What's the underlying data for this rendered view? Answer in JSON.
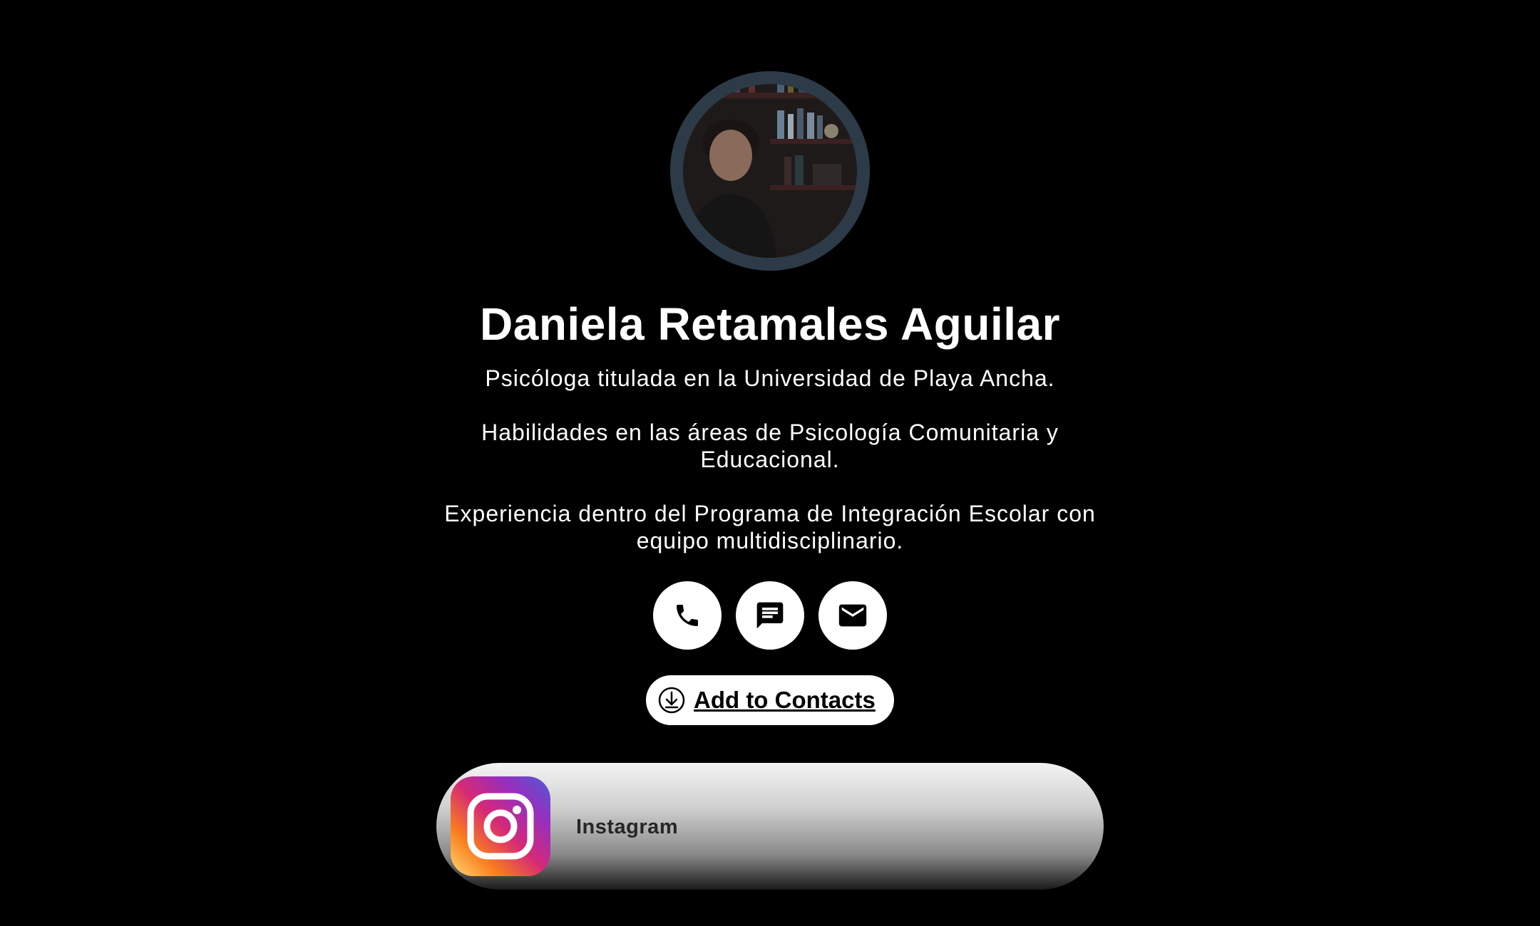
{
  "profile": {
    "name": "Daniela Retamales Aguilar",
    "avatar_icon": "profile-photo",
    "bio": [
      "Psicóloga titulada en la Universidad de Playa Ancha.",
      "Habilidades en las áreas de Psicología Comunitaria y Educacional.",
      "Experiencia dentro del Programa de Integración Escolar con equipo multidisciplinario."
    ]
  },
  "actions": {
    "buttons": [
      {
        "icon": "phone-icon"
      },
      {
        "icon": "message-icon"
      },
      {
        "icon": "email-icon"
      }
    ],
    "add_contacts_label": "Add to Contacts",
    "add_contacts_icon": "download-icon"
  },
  "links": [
    {
      "label": "Instagram",
      "icon": "instagram-icon"
    }
  ],
  "colors": {
    "background": "#000000",
    "button_bg": "#ffffff",
    "avatar_ring": "#2c3b47"
  }
}
